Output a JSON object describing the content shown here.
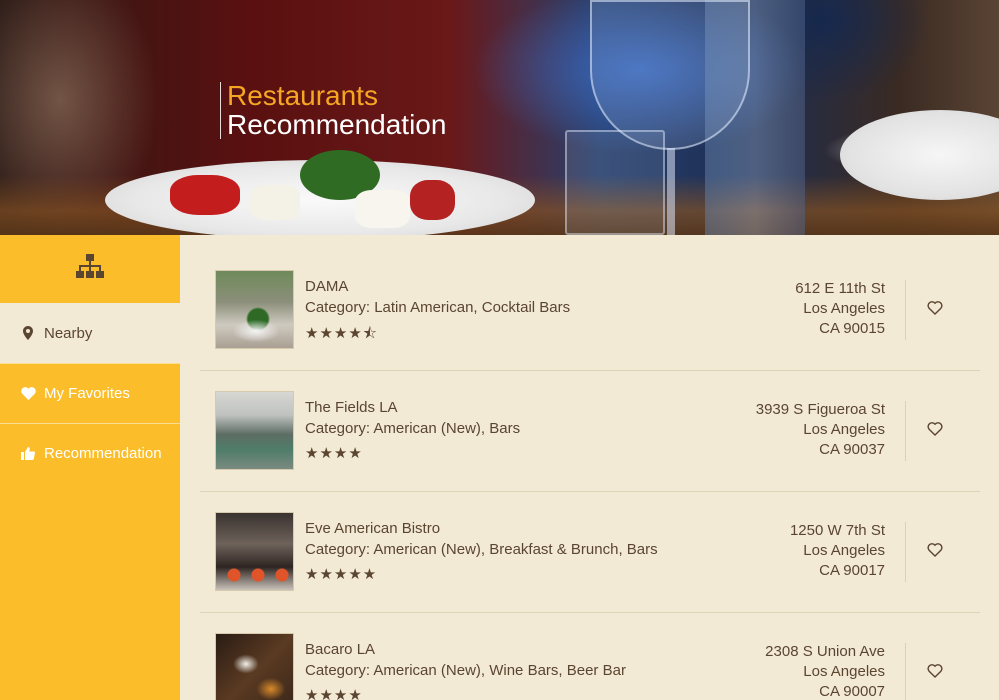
{
  "hero": {
    "title_line1": "Restaurants",
    "title_line2": "Recommendation"
  },
  "sidebar": {
    "top_icon": "sitemap-icon",
    "items": [
      {
        "label": "Nearby",
        "icon": "map-marker-icon",
        "active": true
      },
      {
        "label": "My Favorites",
        "icon": "heart-icon",
        "active": false
      },
      {
        "label": "Recommendation",
        "icon": "thumbs-up-icon",
        "active": false
      }
    ]
  },
  "restaurants": [
    {
      "name": "DAMA",
      "category": "Category: Latin American, Cocktail Bars",
      "stars": "★★★★⯪",
      "rating": 4.5,
      "address1": "612 E 11th St",
      "address2": "Los Angeles",
      "address3": "CA 90015"
    },
    {
      "name": "The Fields LA",
      "category": "Category: American (New), Bars",
      "stars": "★★★★",
      "rating": 4,
      "address1": "3939 S Figueroa St",
      "address2": "Los Angeles",
      "address3": "CA 90037"
    },
    {
      "name": "Eve American Bistro",
      "category": "Category: American (New), Breakfast & Brunch, Bars",
      "stars": "★★★★★",
      "rating": 5,
      "address1": "1250 W 7th St",
      "address2": "Los Angeles",
      "address3": "CA 90017"
    },
    {
      "name": "Bacaro LA",
      "category": "Category: American (New), Wine Bars, Beer Bar",
      "stars": "★★★★",
      "rating": 4,
      "address1": "2308 S Union Ave",
      "address2": "Los Angeles",
      "address3": "CA 90007"
    }
  ],
  "colors": {
    "sidebar": "#fbbd2a",
    "background": "#f3ead6",
    "text": "#5a4530",
    "accent": "#f5a623"
  }
}
